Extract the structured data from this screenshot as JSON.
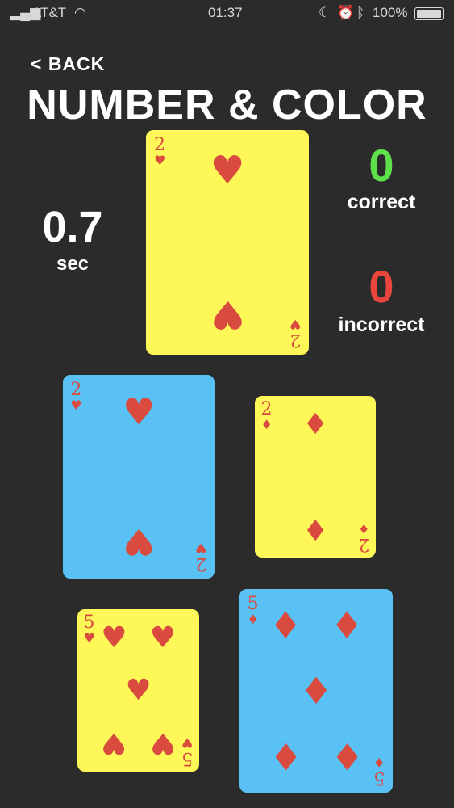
{
  "status": {
    "carrier": "AT&T",
    "time": "01:37",
    "battery": "100%"
  },
  "nav": {
    "back_label": "< BACK"
  },
  "title": "NUMBER & COLOR",
  "timer": {
    "value": "0.7",
    "unit": "sec"
  },
  "scores": {
    "correct": {
      "value": "0",
      "label": "correct",
      "color": "#5de04a"
    },
    "incorrect": {
      "value": "0",
      "label": "incorrect",
      "color": "#e8453c"
    }
  },
  "colors": {
    "yellow": "#fdf858",
    "blue": "#5ac1f5",
    "suit": "#d94a3f",
    "background": "#2b2b2b"
  },
  "cards": [
    {
      "role": "target",
      "rank": "2",
      "suit": "hearts",
      "color": "yellow"
    },
    {
      "role": "option",
      "rank": "2",
      "suit": "hearts",
      "color": "blue"
    },
    {
      "role": "option",
      "rank": "2",
      "suit": "diamonds",
      "color": "yellow"
    },
    {
      "role": "option",
      "rank": "5",
      "suit": "hearts",
      "color": "yellow"
    },
    {
      "role": "option",
      "rank": "5",
      "suit": "diamonds",
      "color": "blue"
    }
  ]
}
